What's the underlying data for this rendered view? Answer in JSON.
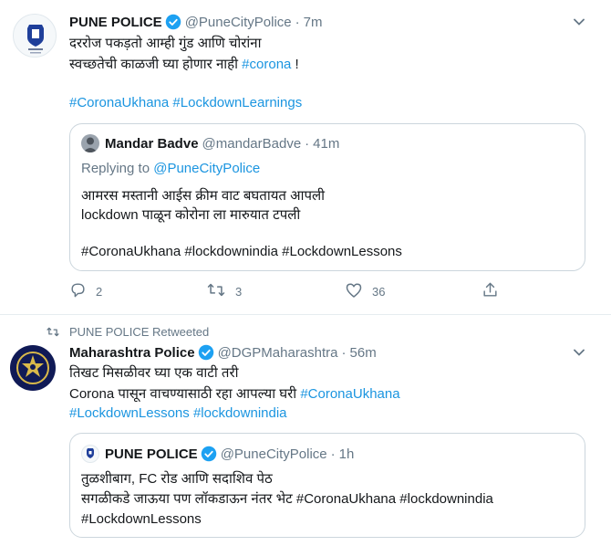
{
  "tweet1": {
    "display_name": "PUNE POLICE",
    "handle": "@PuneCityPolice",
    "separator": "·",
    "time": "7m",
    "text_line1": "दररोज पकड़तो आम्ही गुंड आणि चोरांना",
    "text_line2_prefix": "स्वच्छतेची काळजी घ्या होणार नाही ",
    "text_line2_hashtag": "#corona",
    "text_line2_suffix": " !",
    "hashtag_a": "#CoronaUkhana",
    "hashtag_b": "#LockdownLearnings",
    "quote": {
      "display_name": "Mandar Badve",
      "handle": "@mandarBadve",
      "separator": "·",
      "time": "41m",
      "replying_prefix": "Replying to ",
      "replying_handle": "@PuneCityPolice",
      "text_line1": "आमरस मस्तानी आईस क्रीम वाट बघतायत आपली",
      "text_line2": "lockdown पाळून कोरोना ला मारुयात टपली",
      "hashtags_line": "#CoronaUkhana #lockdownindia #LockdownLessons"
    },
    "actions": {
      "reply_count": "2",
      "retweet_count": "3",
      "like_count": "36"
    }
  },
  "retweet_context": "PUNE POLICE Retweeted",
  "tweet2": {
    "display_name": "Maharashtra Police",
    "handle": "@DGPMaharashtra",
    "separator": "·",
    "time": "56m",
    "text_line1": "तिखट मिसळीवर घ्या एक वाटी तरी",
    "text_line2_prefix": "Corona पासून वाचण्यासाठी रहा आपल्या घरी  ",
    "text_line2_hashtag": "#CoronaUkhana",
    "hashtag_a": "#LockdownLessons",
    "hashtag_b": "#lockdownindia",
    "quote": {
      "display_name": "PUNE POLICE",
      "handle": "@PuneCityPolice",
      "separator": "·",
      "time": "1h",
      "text_line1": "तुळशीबाग, FC रोड आणि सदाशिव पेठ",
      "text_line2_prefix": "सगळीकडे जाऊया पण लॉकडाऊन नंतर भेट ",
      "text_line2_hashtag1": "#CoronaUkhana",
      "text_line2_hashtag2": "#lockdownindia",
      "text_line3_hashtag": "#LockdownLessons"
    }
  },
  "colors": {
    "link": "#1b95e0",
    "secondary": "#657786",
    "verified": "#1da1f2",
    "border": "#ccd6dd"
  },
  "icons": [
    "verified-badge-icon",
    "caret-down-icon",
    "reply-icon",
    "retweet-icon",
    "like-icon",
    "share-icon"
  ]
}
